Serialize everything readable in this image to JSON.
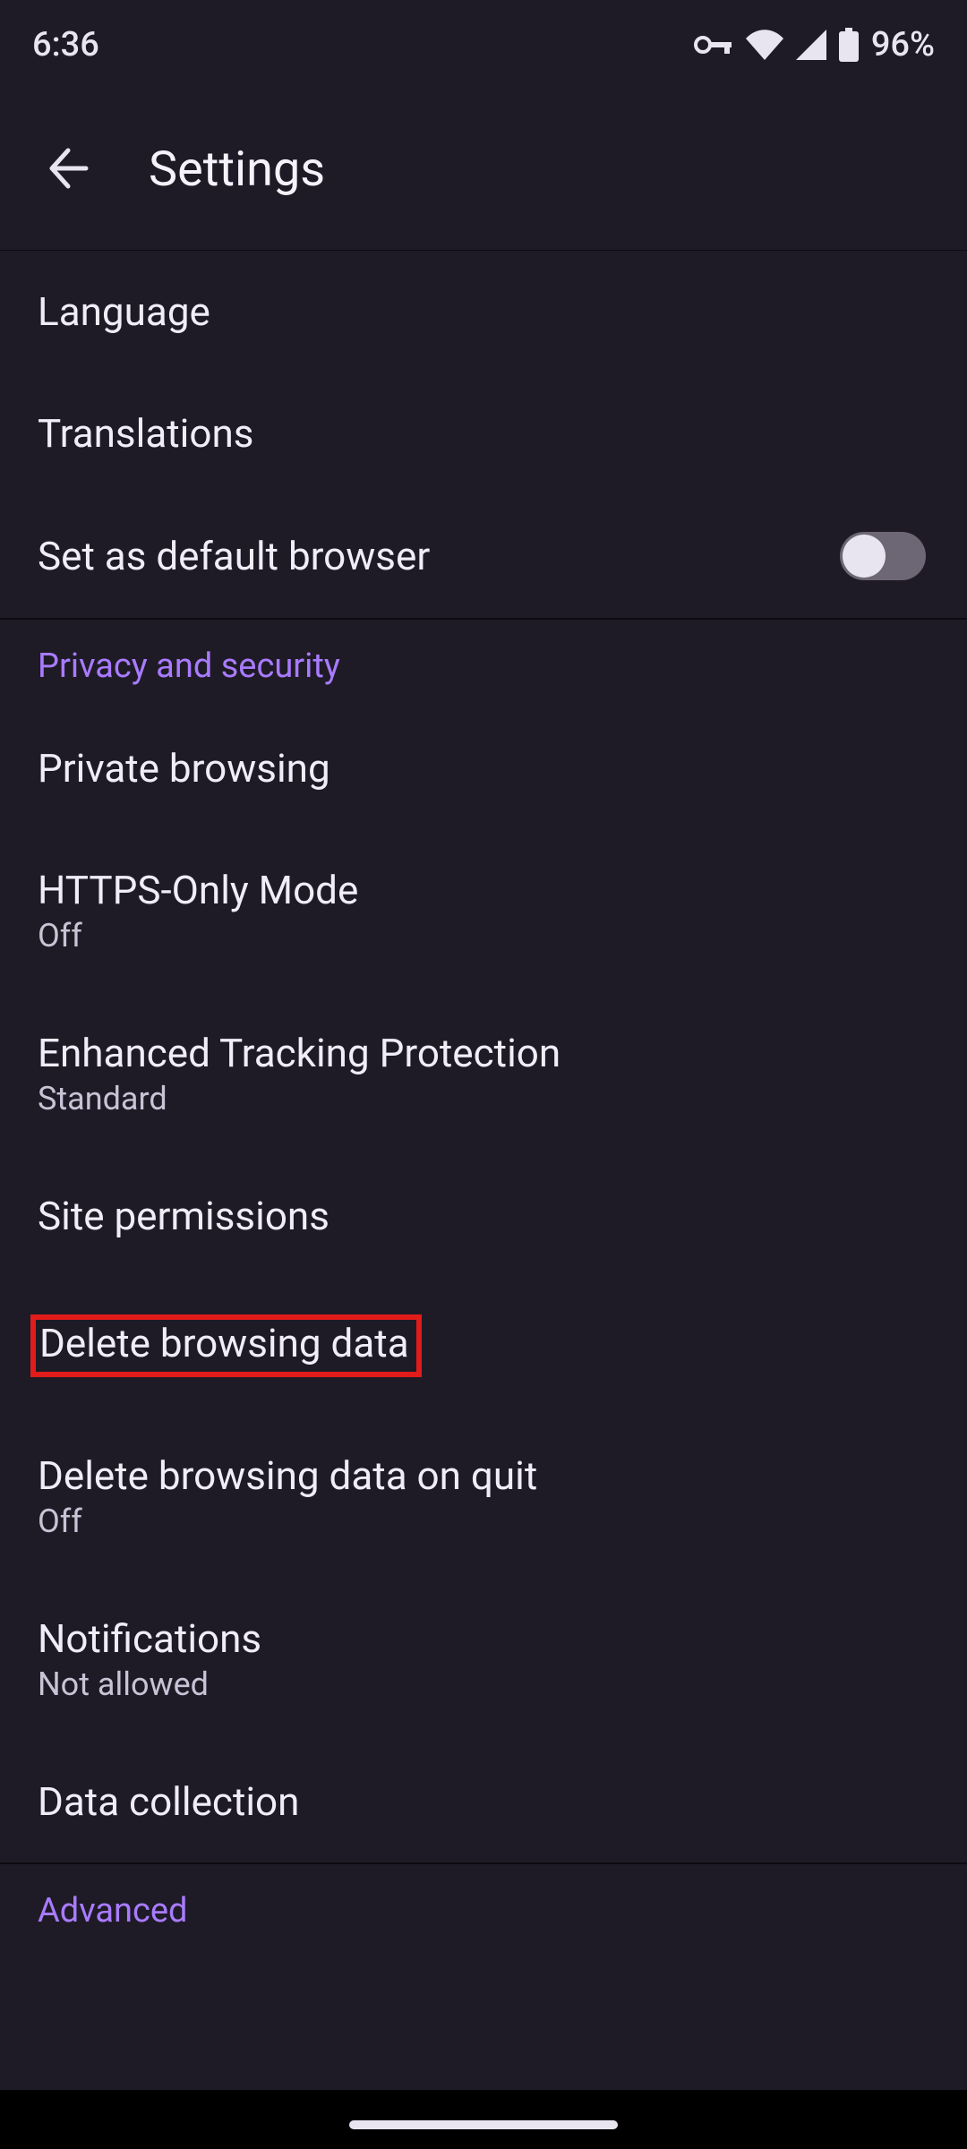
{
  "status": {
    "time": "6:36",
    "battery_pct": "96%"
  },
  "header": {
    "title": "Settings"
  },
  "rows": {
    "language": {
      "label": "Language"
    },
    "translations": {
      "label": "Translations"
    },
    "default_browser": {
      "label": "Set as default browser",
      "toggle": "off"
    },
    "private_browsing": {
      "label": "Private browsing"
    },
    "https_only": {
      "label": "HTTPS-Only Mode",
      "sub": "Off"
    },
    "etp": {
      "label": "Enhanced Tracking Protection",
      "sub": "Standard"
    },
    "site_permissions": {
      "label": "Site permissions"
    },
    "delete_browsing": {
      "label": "Delete browsing data"
    },
    "delete_on_quit": {
      "label": "Delete browsing data on quit",
      "sub": "Off"
    },
    "notifications": {
      "label": "Notifications",
      "sub": "Not allowed"
    },
    "data_collection": {
      "label": "Data collection"
    }
  },
  "sections": {
    "privacy": "Privacy and security",
    "advanced": "Advanced"
  }
}
